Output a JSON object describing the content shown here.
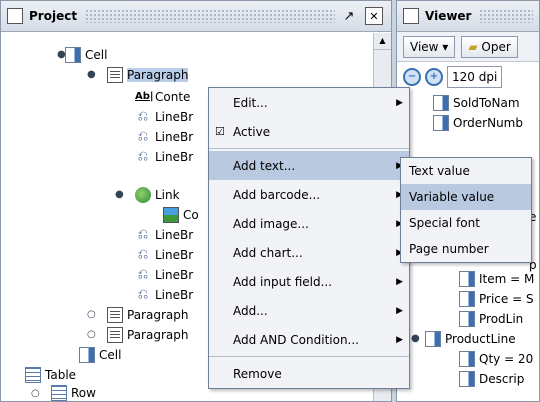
{
  "project": {
    "title": "Project",
    "tree": [
      {
        "label": "Cell",
        "icon": "field-icon"
      },
      {
        "label": "Paragraph",
        "icon": "paragraph-icon"
      },
      {
        "label": "Conte",
        "icon": "text-content-icon"
      },
      {
        "label": "LineBr",
        "icon": "line-break-icon"
      },
      {
        "label": "LineBr",
        "icon": "line-break-icon"
      },
      {
        "label": "LineBr",
        "icon": "line-break-icon"
      },
      {
        "label": "Link",
        "icon": "link-globe-icon"
      },
      {
        "label": "Co",
        "icon": "image-icon"
      },
      {
        "label": "LineBr",
        "icon": "line-break-icon"
      },
      {
        "label": "LineBr",
        "icon": "line-break-icon"
      },
      {
        "label": "LineBr",
        "icon": "line-break-icon"
      },
      {
        "label": "LineBr",
        "icon": "line-break-icon"
      },
      {
        "label": "Paragraph",
        "icon": "paragraph-icon"
      },
      {
        "label": "Paragraph",
        "icon": "paragraph-icon"
      },
      {
        "label": "Cell",
        "icon": "field-icon"
      },
      {
        "label": "Table",
        "icon": "table-icon"
      },
      {
        "label": "Row",
        "icon": "row-icon"
      }
    ]
  },
  "viewer": {
    "title": "Viewer",
    "view_label": "View",
    "open_label": "Oper",
    "dpi": "120 dpi",
    "tree": [
      "SoldToNam",
      "OrderNumb",
      "e",
      "p",
      "Item = M",
      "Price = S",
      "ProdLin",
      "ProductLine",
      "Qty = 20",
      "Descrip"
    ]
  },
  "context_menu": {
    "items": [
      "Edit...",
      "Active",
      "Add text...",
      "Add barcode...",
      "Add image...",
      "Add chart...",
      "Add input field...",
      "Add...",
      "Add AND Condition...",
      "Remove"
    ]
  },
  "submenu": {
    "items": [
      "Text value",
      "Variable value",
      "Special font",
      "Page number"
    ]
  }
}
